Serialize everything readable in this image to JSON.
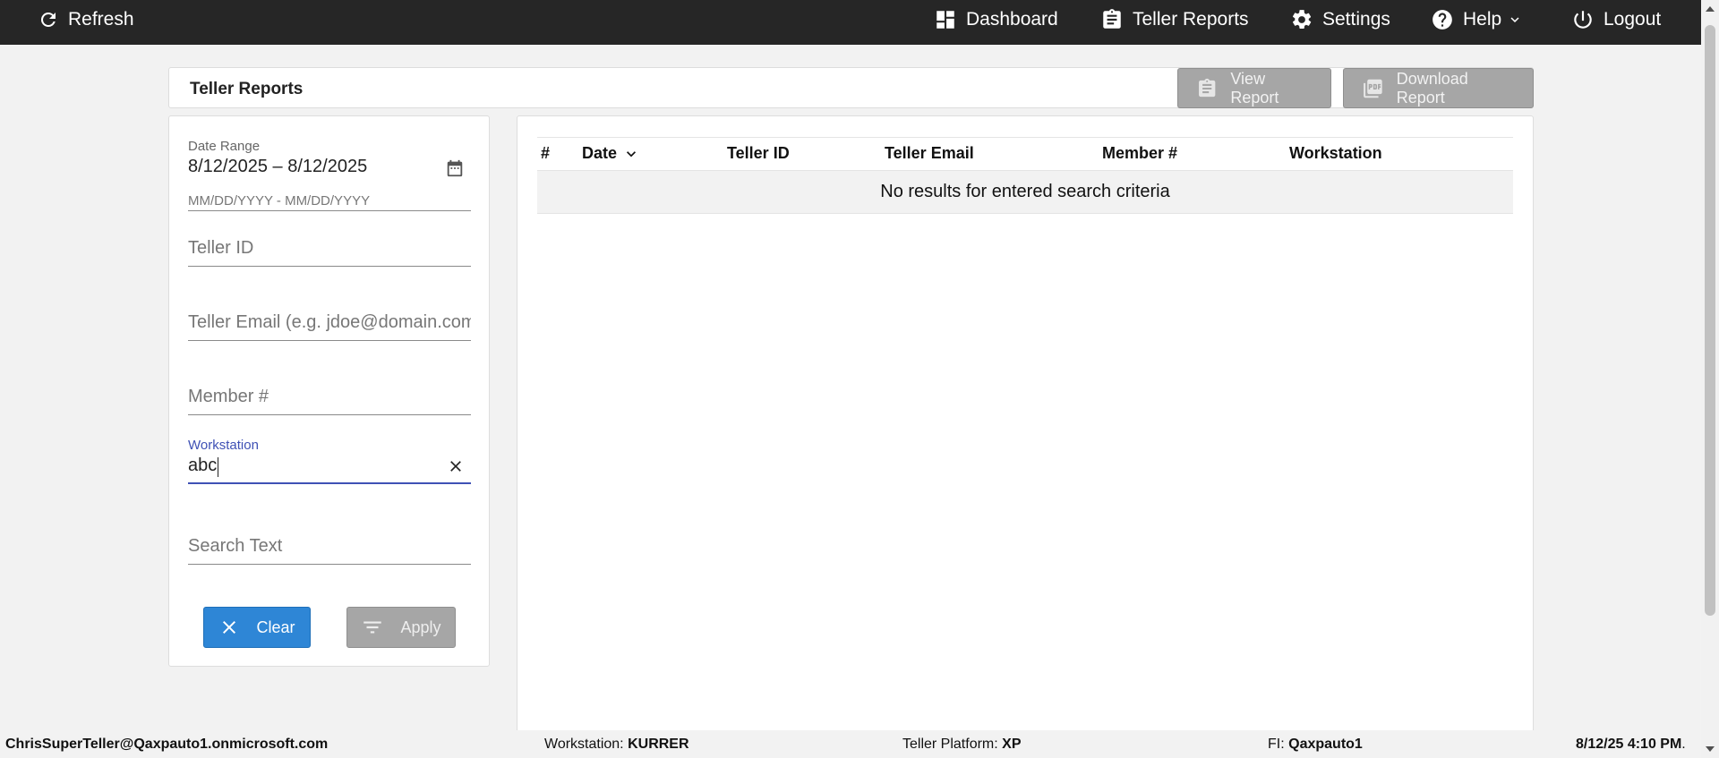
{
  "topbar": {
    "refresh": "Refresh",
    "dashboard": "Dashboard",
    "teller_reports": "Teller Reports",
    "settings": "Settings",
    "help": "Help",
    "logout": "Logout"
  },
  "title_panel": {
    "title": "Teller Reports",
    "view_report": "View Report",
    "download_report": "Download Report"
  },
  "filters": {
    "date_range_label": "Date Range",
    "date_range_value": "8/12/2025 – 8/12/2025",
    "date_range_hint": "MM/DD/YYYY - MM/DD/YYYY",
    "teller_id_placeholder": "Teller ID",
    "teller_email_placeholder": "Teller Email (e.g. jdoe@domain.com)",
    "member_placeholder": "Member #",
    "workstation_label": "Workstation",
    "workstation_value": "abc",
    "search_text_placeholder": "Search Text",
    "clear": "Clear",
    "apply": "Apply"
  },
  "table": {
    "columns": [
      "#",
      "Date",
      "Teller ID",
      "Teller Email",
      "Member #",
      "Workstation"
    ],
    "empty_message": "No results for entered search criteria"
  },
  "statusbar": {
    "user": "ChrisSuperTeller@Qaxpauto1.onmicrosoft.com",
    "workstation_label": "Workstation:",
    "workstation_value": "KURRER",
    "platform_label": "Teller Platform:",
    "platform_value": "XP",
    "fi_label": "FI:",
    "fi_value": "Qaxpauto1",
    "datetime": "8/12/25 4:10 PM",
    "datetime_suffix": "."
  },
  "colors": {
    "topbar_bg": "#262626",
    "primary_button": "#2e86d6",
    "disabled_button": "#a6a6a6",
    "focus_accent": "#3f51b5"
  }
}
